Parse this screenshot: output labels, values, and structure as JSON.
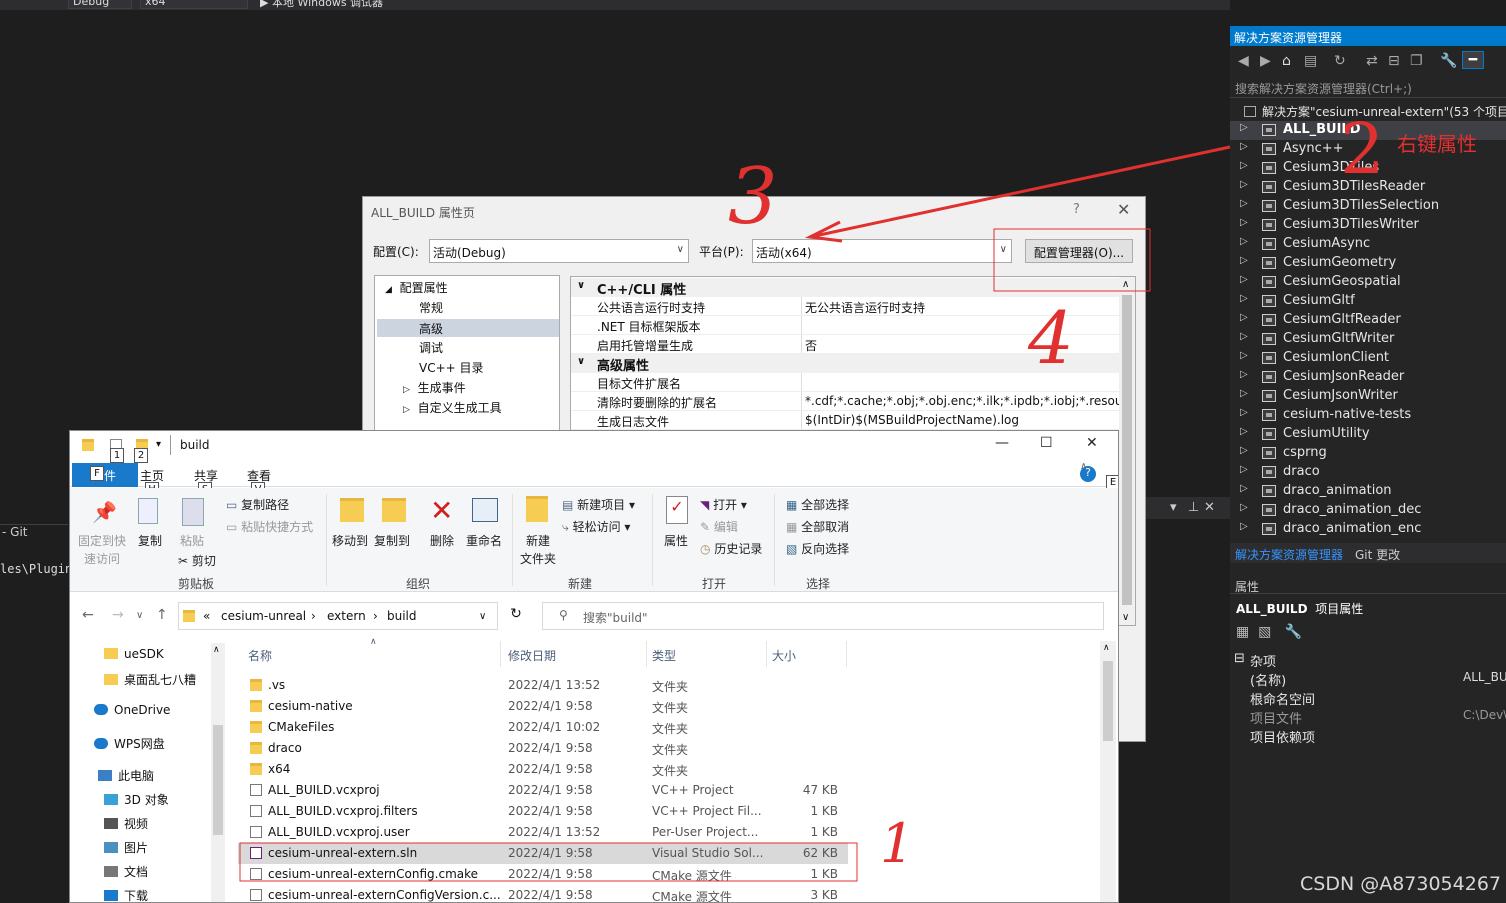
{
  "vs_toolbar": {
    "config": "Debug",
    "platform": "x64",
    "run": "▶ 本地 Windows 调试器"
  },
  "left_panel": {
    "git_tab": "- Git",
    "output_text": "les\\Plugins"
  },
  "solution_explorer": {
    "title": "解决方案资源管理器",
    "search_placeholder": "搜索解决方案资源管理器(Ctrl+;)",
    "root": "解决方案\"cesium-unreal-extern\"(53 个项目",
    "projects": [
      "ALL_BUILD",
      "Async++",
      "Cesium3DTiles",
      "Cesium3DTilesReader",
      "Cesium3DTilesSelection",
      "Cesium3DTilesWriter",
      "CesiumAsync",
      "CesiumGeometry",
      "CesiumGeospatial",
      "CesiumGltf",
      "CesiumGltfReader",
      "CesiumGltfWriter",
      "CesiumIonClient",
      "CesiumJsonReader",
      "CesiumJsonWriter",
      "cesium-native-tests",
      "CesiumUtility",
      "csprng",
      "draco",
      "draco_animation",
      "draco_animation_dec",
      "draco_animation_enc"
    ],
    "tabs": [
      "解决方案资源管理器",
      "Git 更改"
    ]
  },
  "properties": {
    "title": "属性",
    "object": "ALL_BUILD",
    "object_suffix": "项目属性",
    "category": "杂项",
    "rows": [
      {
        "key": "(名称)",
        "value": "ALL_BU",
        "dim": false
      },
      {
        "key": "根命名空间",
        "value": "",
        "dim": false
      },
      {
        "key": "项目文件",
        "value": "C:\\Dev\\",
        "dim": true
      },
      {
        "key": "项目依赖项",
        "value": "",
        "dim": false
      }
    ]
  },
  "dialog": {
    "title": "ALL_BUILD 属性页",
    "help": "?",
    "config_label": "配置(C):",
    "config_value": "活动(Debug)",
    "platform_label": "平台(P):",
    "platform_value": "活动(x64)",
    "config_manager": "配置管理器(O)...",
    "tree": {
      "root": "配置属性",
      "items": [
        "常规",
        "高级",
        "调试",
        "VC++ 目录"
      ],
      "selected": "高级",
      "expandable": [
        "生成事件",
        "自定义生成工具"
      ]
    },
    "groups": [
      {
        "name": "C++/CLI 属性",
        "rows": [
          {
            "key": "公共语言运行时支持",
            "value": "无公共语言运行时支持"
          },
          {
            "key": ".NET 目标框架版本",
            "value": ""
          },
          {
            "key": "启用托管增量生成",
            "value": "否"
          }
        ]
      },
      {
        "name": "高级属性",
        "rows": [
          {
            "key": "目标文件扩展名",
            "value": ""
          },
          {
            "key": "清除时要删除的扩展名",
            "value": "*.cdf;*.cache;*.obj;*.obj.enc;*.ilk;*.ipdb;*.iobj;*.resources"
          },
          {
            "key": "生成日志文件",
            "value": "$(IntDir)$(MSBuildProjectName).log"
          }
        ]
      }
    ]
  },
  "explorer": {
    "title": "build",
    "tabs": {
      "file": "文件",
      "home": "主页",
      "share": "共享",
      "view": "查看"
    },
    "keytips": {
      "k1": "1",
      "k2": "2",
      "f": "F",
      "h": "H",
      "s": "S",
      "v": "V",
      "e": "E"
    },
    "ribbon": {
      "pin": "固定到快\n速访问",
      "pin1": "固定到快",
      "pin2": "速访问",
      "copy": "复制",
      "paste": "粘贴",
      "copy_path": "复制路径",
      "paste_shortcut": "粘贴快捷方式",
      "cut": "剪切",
      "move_to": "移动到",
      "copy_to": "复制到",
      "delete": "删除",
      "rename": "重命名",
      "new_folder1": "新建",
      "new_folder2": "文件夹",
      "new_item": "新建项目 ▾",
      "easy_access": "轻松访问 ▾",
      "properties": "属性",
      "open": "打开 ▾",
      "edit": "编辑",
      "history": "历史记录",
      "select_all": "全部选择",
      "select_none": "全部取消",
      "invert": "反向选择",
      "groups": [
        "剪贴板",
        "组织",
        "新建",
        "打开",
        "选择"
      ]
    },
    "path": [
      "cesium-unreal",
      "extern",
      "build"
    ],
    "search_placeholder": "搜索\"build\"",
    "nav": [
      "ueSDK",
      "桌面乱七八糟",
      "OneDrive",
      "WPS网盘",
      "此电脑",
      "3D 对象",
      "视频",
      "图片",
      "文档",
      "下载"
    ],
    "columns": [
      "名称",
      "修改日期",
      "类型",
      "大小"
    ],
    "files": [
      {
        "name": ".vs",
        "date": "2022/4/1 13:52",
        "type": "文件夹",
        "size": "",
        "kind": "folder"
      },
      {
        "name": "cesium-native",
        "date": "2022/4/1 9:58",
        "type": "文件夹",
        "size": "",
        "kind": "folder"
      },
      {
        "name": "CMakeFiles",
        "date": "2022/4/1 10:02",
        "type": "文件夹",
        "size": "",
        "kind": "folder"
      },
      {
        "name": "draco",
        "date": "2022/4/1 9:58",
        "type": "文件夹",
        "size": "",
        "kind": "folder"
      },
      {
        "name": "x64",
        "date": "2022/4/1 9:58",
        "type": "文件夹",
        "size": "",
        "kind": "folder"
      },
      {
        "name": "ALL_BUILD.vcxproj",
        "date": "2022/4/1 9:58",
        "type": "VC++ Project",
        "size": "47 KB",
        "kind": "file"
      },
      {
        "name": "ALL_BUILD.vcxproj.filters",
        "date": "2022/4/1 9:58",
        "type": "VC++ Project Fil...",
        "size": "1 KB",
        "kind": "file"
      },
      {
        "name": "ALL_BUILD.vcxproj.user",
        "date": "2022/4/1 13:52",
        "type": "Per-User Project...",
        "size": "1 KB",
        "kind": "file"
      },
      {
        "name": "cesium-unreal-extern.sln",
        "date": "2022/4/1 9:58",
        "type": "Visual Studio Sol...",
        "size": "62 KB",
        "kind": "sln"
      },
      {
        "name": "cesium-unreal-externConfig.cmake",
        "date": "2022/4/1 9:58",
        "type": "CMake 源文件",
        "size": "1 KB",
        "kind": "file"
      },
      {
        "name": "cesium-unreal-externConfigVersion.c...",
        "date": "2022/4/1 9:58",
        "type": "CMake 源文件",
        "size": "3 KB",
        "kind": "file"
      }
    ]
  },
  "annotations": {
    "n1": "1",
    "n2": "2",
    "n3": "3",
    "n4": "4",
    "right_click": "右键属性"
  },
  "watermark": "CSDN @A873054267",
  "colors": {
    "accent": "#007acc",
    "annotation": "#e03030",
    "vs_bg": "#1e1e1e"
  }
}
